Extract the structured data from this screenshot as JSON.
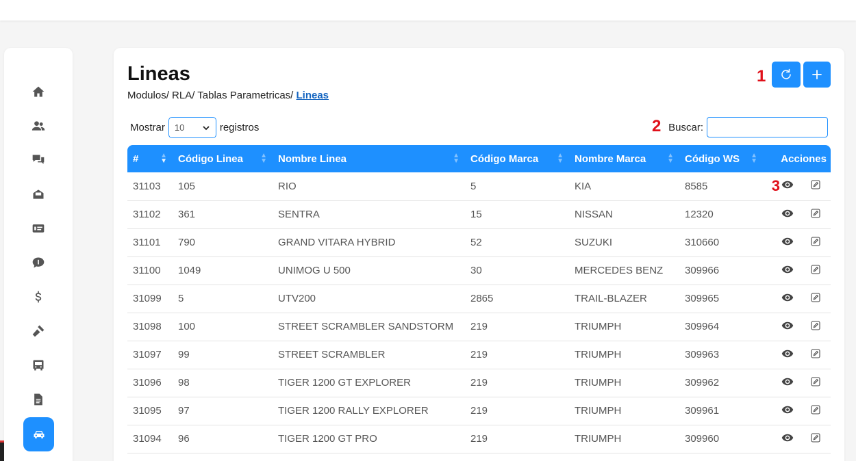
{
  "page": {
    "title": "Lineas",
    "breadcrumb": {
      "path": "Modulos/ RLA/ Tablas Parametricas/ ",
      "current": "Lineas"
    }
  },
  "markers": {
    "m1": "1",
    "m2": "2",
    "m3": "3"
  },
  "toolbar": {
    "refresh_icon": "refresh-icon",
    "add_icon": "plus-icon"
  },
  "length_menu": {
    "prefix": "Mostrar",
    "value": "10",
    "suffix": "registros"
  },
  "search": {
    "label": "Buscar:",
    "value": ""
  },
  "sidebar": {
    "items": [
      "home-icon",
      "users-icon",
      "chat-question-icon",
      "inbox-icon",
      "money-list-icon",
      "comment-dollar-icon",
      "dollar-icon",
      "gavel-icon",
      "bus-icon",
      "document-icon",
      "car-icon"
    ],
    "active": "car-icon"
  },
  "table": {
    "headers": [
      "#",
      "Código Linea",
      "Nombre Linea",
      "Código Marca",
      "Nombre Marca",
      "Código WS",
      "Acciones"
    ],
    "rows": [
      [
        "31103",
        "105",
        "RIO",
        "5",
        "KIA",
        "8585"
      ],
      [
        "31102",
        "361",
        "SENTRA",
        "15",
        "NISSAN",
        "12320"
      ],
      [
        "31101",
        "790",
        "GRAND VITARA HYBRID",
        "52",
        "SUZUKI",
        "310660"
      ],
      [
        "31100",
        "1049",
        "UNIMOG U 500",
        "30",
        "MERCEDES BENZ",
        "309966"
      ],
      [
        "31099",
        "5",
        "UTV200",
        "2865",
        "TRAIL-BLAZER",
        "309965"
      ],
      [
        "31098",
        "100",
        "STREET SCRAMBLER SANDSTORM",
        "219",
        "TRIUMPH",
        "309964"
      ],
      [
        "31097",
        "99",
        "STREET SCRAMBLER",
        "219",
        "TRIUMPH",
        "309963"
      ],
      [
        "31096",
        "98",
        "TIGER 1200 GT EXPLORER",
        "219",
        "TRIUMPH",
        "309962"
      ],
      [
        "31095",
        "97",
        "TIGER 1200 RALLY EXPLORER",
        "219",
        "TRIUMPH",
        "309961"
      ],
      [
        "31094",
        "96",
        "TIGER 1200 GT PRO",
        "219",
        "TRIUMPH",
        "309960"
      ]
    ]
  },
  "colors": {
    "accent": "#1e90ff",
    "marker": "#e0101a"
  }
}
